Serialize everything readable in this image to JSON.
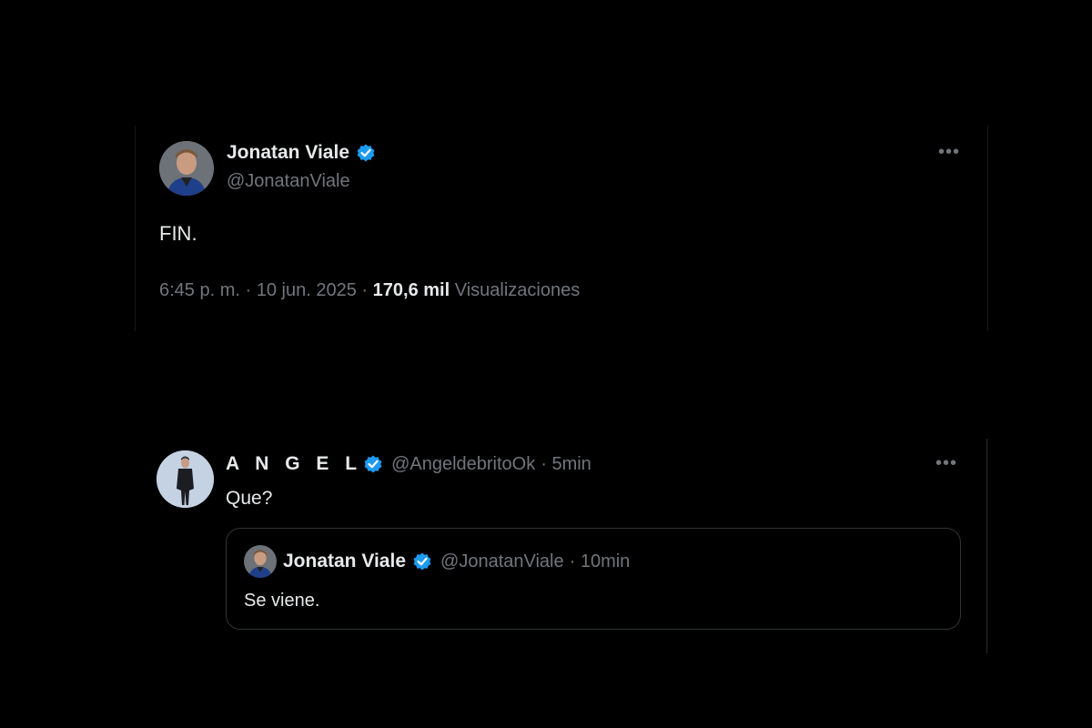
{
  "tweet": {
    "author_name": "Jonatan Viale",
    "author_handle": "@JonatanViale",
    "text": "FIN.",
    "time": "6:45 p. m.",
    "separator": "·",
    "date": "10 jun. 2025",
    "views_count": "170,6 mil",
    "views_label": "Visualizaciones",
    "more_icon": "ellipsis-icon"
  },
  "reply": {
    "author_name": "A N G E L",
    "author_handle": "@AngeldebritoOk",
    "time": "· 5min",
    "text": "Que?",
    "more_icon": "ellipsis-icon",
    "quoted": {
      "author_name": "Jonatan Viale",
      "author_handle": "@JonatanViale",
      "time": "· 10min",
      "text": "Se viene."
    }
  },
  "colors": {
    "background": "#000000",
    "primary_text": "#e7e9ea",
    "secondary_text": "#71767b",
    "verified_badge": "#1d9bf0",
    "quote_border": "#2f3336"
  }
}
